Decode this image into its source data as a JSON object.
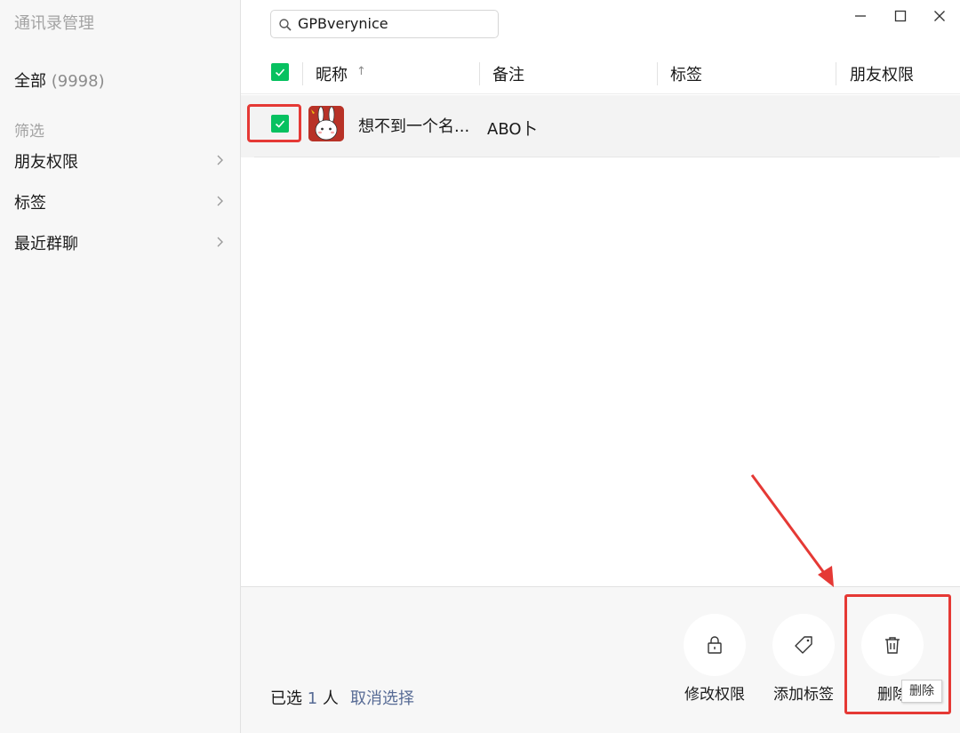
{
  "sidebar": {
    "app_title": "通讯录管理",
    "all_label": "全部",
    "all_count": "(9998)",
    "filter_label": "筛选",
    "items": [
      {
        "label": "朋友权限"
      },
      {
        "label": "标签"
      },
      {
        "label": "最近群聊"
      }
    ]
  },
  "search": {
    "value": "GPBverynice"
  },
  "window_controls": {
    "icons": [
      "minimize-icon",
      "maximize-icon",
      "close-icon"
    ]
  },
  "table": {
    "columns": [
      {
        "label": "昵称",
        "sort": "↑"
      },
      {
        "label": "备注"
      },
      {
        "label": "标签"
      },
      {
        "label": "朋友权限"
      }
    ],
    "rows": [
      {
        "nickname": "想不到一个名...",
        "remark": "ABO卜",
        "tags": "",
        "permission": "",
        "checked": true
      }
    ]
  },
  "footer": {
    "selected_prefix": "已选",
    "selected_count": "1",
    "selected_suffix": "人",
    "cancel_label": "取消选择",
    "actions": [
      {
        "label": "修改权限",
        "icon": "lock-icon"
      },
      {
        "label": "添加标签",
        "icon": "tag-icon"
      },
      {
        "label": "删除",
        "icon": "trash-icon"
      }
    ],
    "tooltip": "删除"
  },
  "colors": {
    "accent_green": "#07c160",
    "link_blue": "#576b95",
    "annotation_red": "#e53935"
  }
}
